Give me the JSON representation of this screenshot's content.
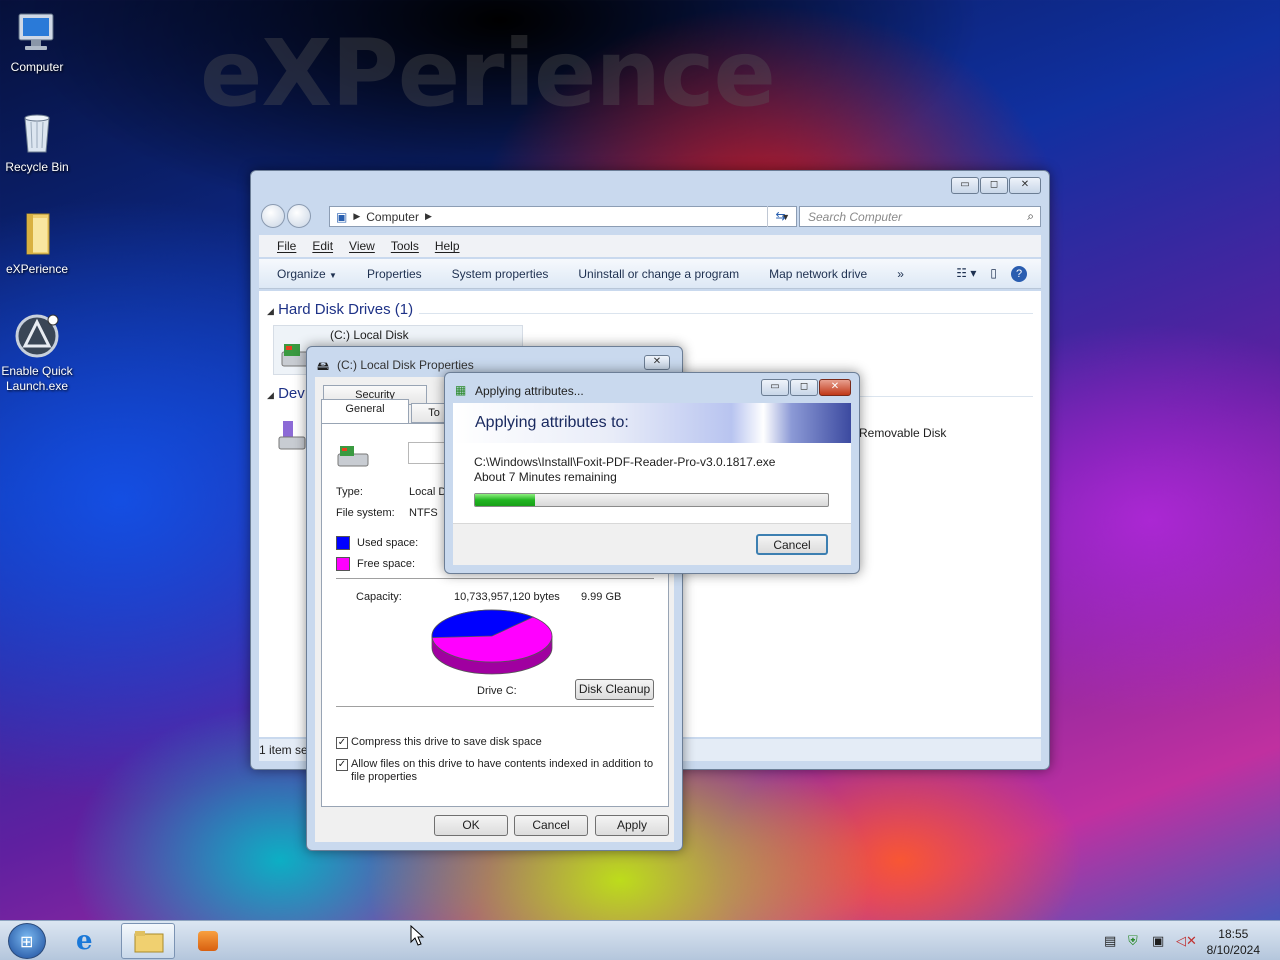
{
  "desktop": {
    "watermark": "eXPerience",
    "icons": [
      {
        "label": "Computer",
        "icon": "computer-icon"
      },
      {
        "label": "Recycle Bin",
        "icon": "recycle-bin-icon"
      },
      {
        "label": "eXPerience",
        "icon": "folder-icon"
      },
      {
        "label": "Enable Quick Launch.exe",
        "icon": "app-icon"
      }
    ]
  },
  "explorer": {
    "breadcrumb": "Computer",
    "search_placeholder": "Search Computer",
    "menu": [
      "File",
      "Edit",
      "View",
      "Tools",
      "Help"
    ],
    "commands": [
      "Organize",
      "Properties",
      "System properties",
      "Uninstall or change a program",
      "Map network drive"
    ],
    "overflow": "»",
    "groups": {
      "hard_disks": "Hard Disk Drives (1)",
      "devices": "Dev"
    },
    "drive_name": "(C:) Local Disk",
    "removable": "Removable Disk",
    "status": "1 item se"
  },
  "properties": {
    "title": "(C:) Local Disk Properties",
    "tabs": {
      "security": "Security",
      "general": "General",
      "tools": "To"
    },
    "type_label": "Type:",
    "type_value": "Local D",
    "fs_label": "File system:",
    "fs_value": "NTFS",
    "used_label": "Used space:",
    "free_label": "Free space:",
    "capacity_label": "Capacity:",
    "capacity_bytes": "10,733,957,120 bytes",
    "capacity_gb": "9.99 GB",
    "drive_label": "Drive C:",
    "disk_cleanup": "Disk Cleanup",
    "compress": "Compress this drive to save disk space",
    "index_line1": "Allow files on this drive to have contents indexed in addition to",
    "index_line2": "file properties",
    "ok": "OK",
    "cancel": "Cancel",
    "apply": "Apply",
    "colors": {
      "used": "#0000ff",
      "free": "#ff00ff"
    },
    "used_fraction": 0.38
  },
  "applying": {
    "title": "Applying attributes...",
    "header": "Applying attributes to:",
    "file": "C:\\Windows\\Install\\Foxit-PDF-Reader-Pro-v3.0.1817.exe",
    "remaining": "About 7 Minutes remaining",
    "progress_pct": 17,
    "cancel": "Cancel"
  },
  "taskbar": {
    "time": "18:55",
    "date": "8/10/2024"
  }
}
